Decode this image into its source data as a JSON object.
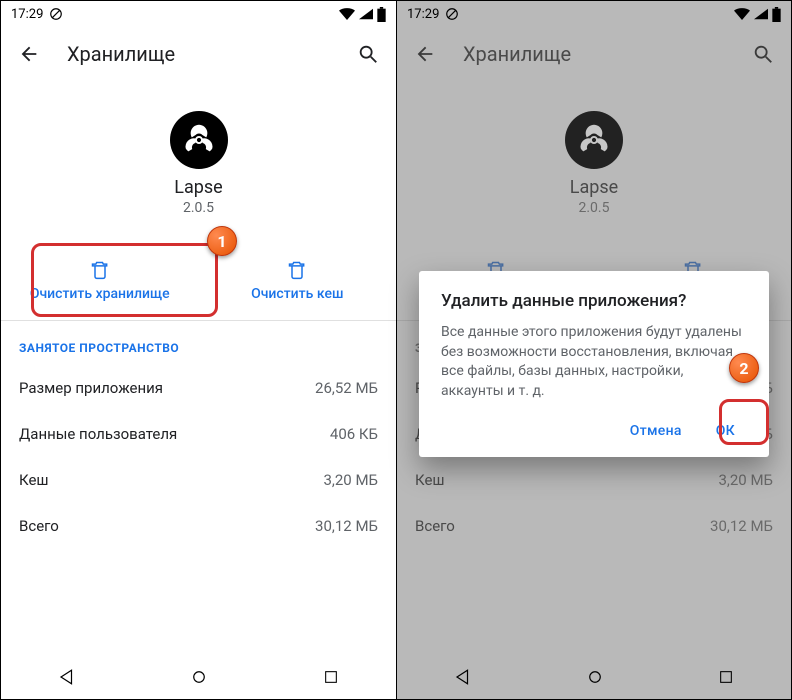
{
  "status": {
    "time": "17:29"
  },
  "appbar": {
    "title": "Хранилище"
  },
  "app": {
    "name": "Lapse",
    "version": "2.0.5"
  },
  "actions": {
    "clear_storage": "Очистить хранилище",
    "clear_cache": "Очистить кеш"
  },
  "section_label": "ЗАНЯТОЕ ПРОСТРАНСТВО",
  "rows": [
    {
      "label": "Размер приложения",
      "value": "26,52 МБ"
    },
    {
      "label": "Данные пользователя",
      "value": "406 КБ"
    },
    {
      "label": "Кеш",
      "value": "3,20 МБ"
    },
    {
      "label": "Всего",
      "value": "30,12 МБ"
    }
  ],
  "dialog": {
    "title": "Удалить данные приложения?",
    "body": "Все данные этого приложения будут удалены без возможности восстановления, включая все файлы, базы данных, настройки, аккаунты и т. д.",
    "cancel": "Отмена",
    "ok": "ОК"
  },
  "badges": {
    "one": "1",
    "two": "2"
  }
}
